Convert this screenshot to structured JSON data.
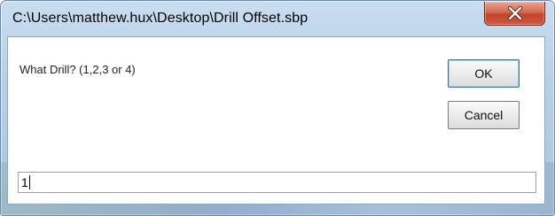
{
  "window": {
    "title": "C:\\Users\\matthew.hux\\Desktop\\Drill Offset.sbp",
    "close_icon": "close-x-icon"
  },
  "dialog": {
    "prompt": "What Drill?  (1,2,3 or 4)",
    "ok_label": "OK",
    "cancel_label": "Cancel",
    "input_value": "1"
  },
  "colors": {
    "close_button": "#c94a30",
    "title_bar": "#b9d1e8",
    "ok_focus_border": "#3b6ea5"
  }
}
